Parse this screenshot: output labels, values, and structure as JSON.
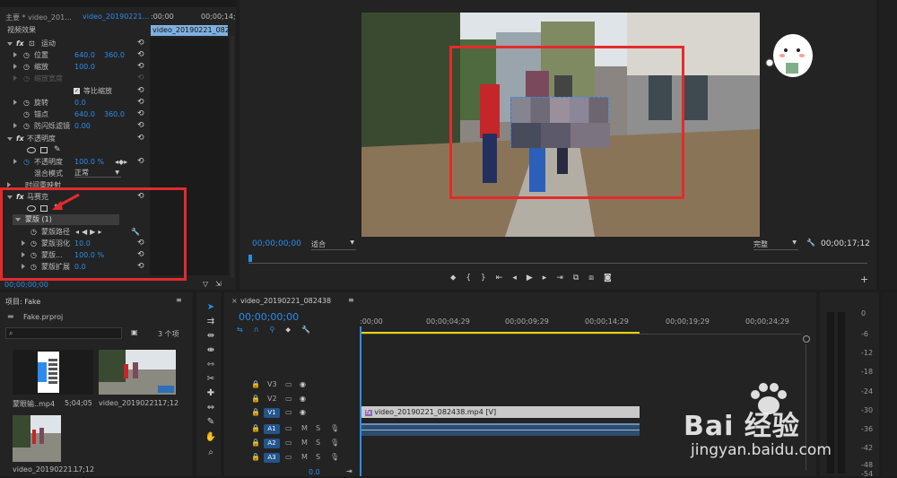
{
  "effect_controls": {
    "tab_master": "主要 * video_201...",
    "tab_clip": "video_20190221...",
    "time_start": ":00;00",
    "time_end": "00;00;14;",
    "clip_label": "video_20190221_082438.mp4",
    "section_video_effects": "视频效果",
    "motion": {
      "name": "运动",
      "position": {
        "label": "位置",
        "x": "640.0",
        "y": "360.0"
      },
      "scale": {
        "label": "缩放",
        "value": "100.0"
      },
      "scale_width": {
        "label": "缩放宽度"
      },
      "uniform_scale": "等比缩放",
      "rotation": {
        "label": "旋转",
        "value": "0.0"
      },
      "anchor": {
        "label": "锚点",
        "x": "640.0",
        "y": "360.0"
      },
      "flicker": {
        "label": "防闪烁滤镜",
        "value": "0.00"
      }
    },
    "opacity": {
      "name": "不透明度",
      "opacity_value": {
        "label": "不透明度",
        "value": "100.0 %"
      },
      "blend": {
        "label": "混合模式",
        "value": "正常"
      }
    },
    "time_remap": "时间重映射",
    "mosaic": {
      "name": "马赛克",
      "mask": "蒙版 (1)",
      "mask_path": "蒙版路径",
      "mask_feather": {
        "label": "蒙版羽化",
        "value": "10.0"
      },
      "mask_opacity": {
        "label": "蒙版...",
        "value": "100.0 %"
      },
      "mask_expand": {
        "label": "蒙版扩展",
        "value": "0.0"
      }
    },
    "footer_time": "00;00;00;00"
  },
  "program": {
    "timecode": "00;00;00;00",
    "fit": "适合",
    "quality": "完整",
    "duration": "00;00;17;12"
  },
  "project": {
    "title": "项目: Fake",
    "file": "Fake.prproj",
    "search_placeholder": "",
    "count": "3 个项",
    "items": [
      {
        "name": "蒙眼输..mp4",
        "duration": "5;04;05"
      },
      {
        "name": "video_20190221...",
        "duration": "17;12"
      },
      {
        "name": "video_20190221...",
        "duration": "17;12"
      }
    ]
  },
  "timeline": {
    "tab": "video_20190221_082438",
    "timecode": "00;00;00;00",
    "ruler": [
      ":00;00",
      "00;00;04;29",
      "00;00;09;29",
      "00;00;14;29",
      "00;00;19;29",
      "00;00;24;29"
    ],
    "tracks_video": [
      "V3",
      "V2",
      "V1"
    ],
    "tracks_audio": [
      "A1",
      "A2",
      "A3"
    ],
    "clip_video": "video_20190221_082438.mp4 [V]",
    "master_value": "0.0"
  },
  "meter_ticks": [
    "0",
    "-6",
    "-12",
    "-18",
    "-24",
    "-30",
    "-36",
    "-42",
    "-48",
    "-54"
  ],
  "watermark": {
    "brand": "Bai 经验",
    "url": "jingyan.baidu.com"
  }
}
